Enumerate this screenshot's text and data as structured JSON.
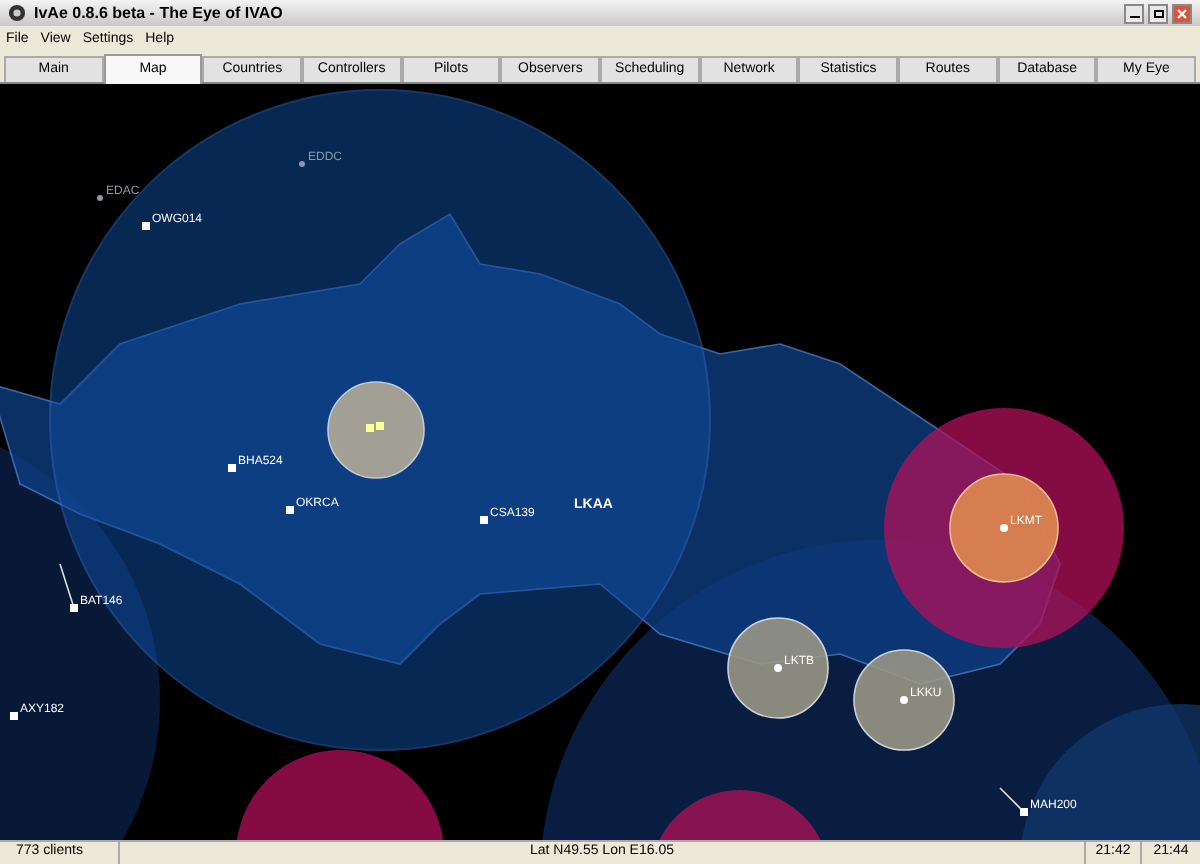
{
  "window": {
    "title": "IvAe 0.8.6 beta - The Eye of IVAO"
  },
  "menu": [
    "File",
    "View",
    "Settings",
    "Help"
  ],
  "tabs": [
    {
      "label": "Main",
      "selected": false
    },
    {
      "label": "Map",
      "selected": true
    },
    {
      "label": "Countries",
      "selected": false
    },
    {
      "label": "Controllers",
      "selected": false
    },
    {
      "label": "Pilots",
      "selected": false
    },
    {
      "label": "Observers",
      "selected": false
    },
    {
      "label": "Scheduling",
      "selected": false
    },
    {
      "label": "Network",
      "selected": false
    },
    {
      "label": "Statistics",
      "selected": false
    },
    {
      "label": "Routes",
      "selected": false
    },
    {
      "label": "Database",
      "selected": false
    },
    {
      "label": "My Eye",
      "selected": false
    }
  ],
  "map": {
    "labels": [
      {
        "kind": "airport",
        "text": "EDDC"
      },
      {
        "kind": "airport",
        "text": "EDAC"
      },
      {
        "kind": "aircraft",
        "text": "OWG014"
      },
      {
        "kind": "aircraft",
        "text": "BHA524"
      },
      {
        "kind": "aircraft",
        "text": "OKRCA"
      },
      {
        "kind": "aircraft",
        "text": "CSA139"
      },
      {
        "kind": "sector",
        "text": "LKAA"
      },
      {
        "kind": "tower",
        "text": "LKMT"
      },
      {
        "kind": "tower",
        "text": "LKTB"
      },
      {
        "kind": "tower",
        "text": "LKKU"
      },
      {
        "kind": "aircraft",
        "text": "BAT146"
      },
      {
        "kind": "aircraft",
        "text": "AXY182"
      },
      {
        "kind": "aircraft",
        "text": "MAH200"
      }
    ]
  },
  "status_bar": {
    "clients": "773 clients",
    "position": "Lat N49.55 Lon E16.05",
    "time_1": "21:42",
    "time_2": "21:44"
  }
}
